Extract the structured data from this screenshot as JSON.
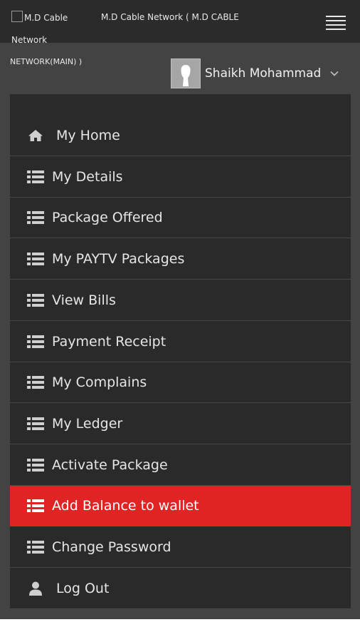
{
  "header": {
    "logo_alt_line1": "M.D Cable",
    "logo_alt_line2": "Network",
    "network_title_line1": "M.D Cable Network ( M.D CABLE",
    "network_title_line2": "NETWORK(MAIN) )",
    "menu_icon": "hamburger-icon"
  },
  "user": {
    "name": "Shaikh Mohammad",
    "avatar_icon": "person-silhouette-icon",
    "dropdown_icon": "chevron-down-icon"
  },
  "menu": {
    "items": [
      {
        "label": "My Home",
        "icon": "home-icon",
        "active": false
      },
      {
        "label": "My Details",
        "icon": "list-icon",
        "active": false
      },
      {
        "label": "Package Offered",
        "icon": "list-icon",
        "active": false
      },
      {
        "label": "My PAYTV Packages",
        "icon": "list-icon",
        "active": false
      },
      {
        "label": "View Bills",
        "icon": "list-icon",
        "active": false
      },
      {
        "label": "Payment Receipt",
        "icon": "list-icon",
        "active": false
      },
      {
        "label": "My Complains",
        "icon": "list-icon",
        "active": false
      },
      {
        "label": "My Ledger",
        "icon": "list-icon",
        "active": false
      },
      {
        "label": "Activate Package",
        "icon": "list-icon",
        "active": false
      },
      {
        "label": "Add Balance to wallet",
        "icon": "list-icon",
        "active": true
      },
      {
        "label": "Change Password",
        "icon": "list-icon",
        "active": false
      },
      {
        "label": "Log Out",
        "icon": "user-icon",
        "active": false
      }
    ]
  },
  "colors": {
    "active_item": "#e02424",
    "menu_bg": "#2a2a2a",
    "page_bg": "#434343",
    "topbar_bg": "#2b2b2b"
  }
}
